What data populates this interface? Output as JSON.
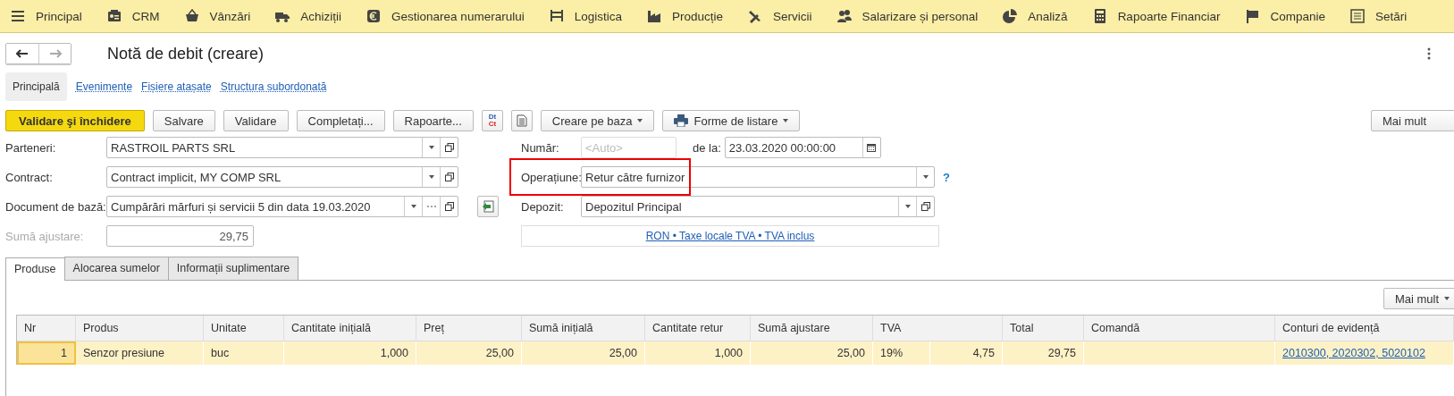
{
  "nav": {
    "items": [
      {
        "label": "Principal"
      },
      {
        "label": "CRM"
      },
      {
        "label": "Vânzări"
      },
      {
        "label": "Achiziții"
      },
      {
        "label": "Gestionarea numerarului"
      },
      {
        "label": "Logistica"
      },
      {
        "label": "Producție"
      },
      {
        "label": "Servicii"
      },
      {
        "label": "Salarizare și personal"
      },
      {
        "label": "Analiză"
      },
      {
        "label": "Rapoarte Financiar"
      },
      {
        "label": "Companie"
      },
      {
        "label": "Setări"
      }
    ]
  },
  "window": {
    "title": "Notă de debit (creare)"
  },
  "form_tabs": [
    {
      "label": "Principală",
      "selected": true
    },
    {
      "label": "Evenimente",
      "selected": false
    },
    {
      "label": "Fișiere atașate",
      "selected": false
    },
    {
      "label": "Structura subordonată",
      "selected": false
    }
  ],
  "toolbar": {
    "buttons": [
      {
        "kind": "primary",
        "label": "Validare şi închidere"
      },
      {
        "kind": "plain",
        "label": "Salvare"
      },
      {
        "kind": "plain",
        "label": "Validare"
      },
      {
        "kind": "plain",
        "label": "Completați..."
      },
      {
        "kind": "plain",
        "label": "Rapoarte..."
      },
      {
        "kind": "dtct",
        "top": "Dt",
        "bottom": "Ct"
      },
      {
        "kind": "document"
      },
      {
        "kind": "dropdown",
        "label": "Creare pe baza"
      },
      {
        "kind": "print",
        "label": "Forme de listare"
      }
    ],
    "more": "Mai mult"
  },
  "form": {
    "left": [
      {
        "kind": "reference",
        "label": "Parteneri:",
        "value": "RASTROIL PARTS SRL"
      },
      {
        "kind": "reference",
        "label": "Contract:",
        "value": "Contract implicit, MY COMP SRL"
      },
      {
        "kind": "choice",
        "label": "Document de bază:",
        "value": "Cumpărări mărfuri și servicii 5 din data 19.03.2020"
      },
      {
        "kind": "readonly",
        "label": "Sumă ajustare:",
        "value": "29,75"
      }
    ],
    "number": {
      "label": "Număr:",
      "placeholder": "<Auto>",
      "date_label": "de la:",
      "date": "23.03.2020 00:00:00"
    },
    "operation": {
      "label": "Operațiune:",
      "value": "Retur către furnizor",
      "help": "?",
      "highlighted": true
    },
    "warehouse": {
      "label": "Depozit:",
      "value": "Depozitul Principal"
    },
    "pricing_link": "RON • Taxe locale TVA • TVA inclus"
  },
  "tabs": [
    {
      "label": "Produse",
      "selected": true
    },
    {
      "label": "Alocarea sumelor",
      "selected": false
    },
    {
      "label": "Informații suplimentare",
      "selected": false
    }
  ],
  "table_more": "Mai mult",
  "table": {
    "columns": [
      "Nr",
      "Produs",
      "Unitate",
      "Cantitate inițială",
      "Preț",
      "Sumă inițială",
      "Cantitate retur",
      "Sumă ajustare",
      "TVA",
      "Total",
      "Comandă",
      "Conturi de evidență"
    ],
    "rows": [
      {
        "selected": true,
        "cells": [
          "1",
          "Senzor presiune",
          "buc",
          "1,000",
          "25,00",
          "25,00",
          "1,000",
          "25,00",
          "19%",
          "4,75",
          "29,75",
          "",
          "2010300, 2020302, 5020102"
        ]
      }
    ]
  }
}
